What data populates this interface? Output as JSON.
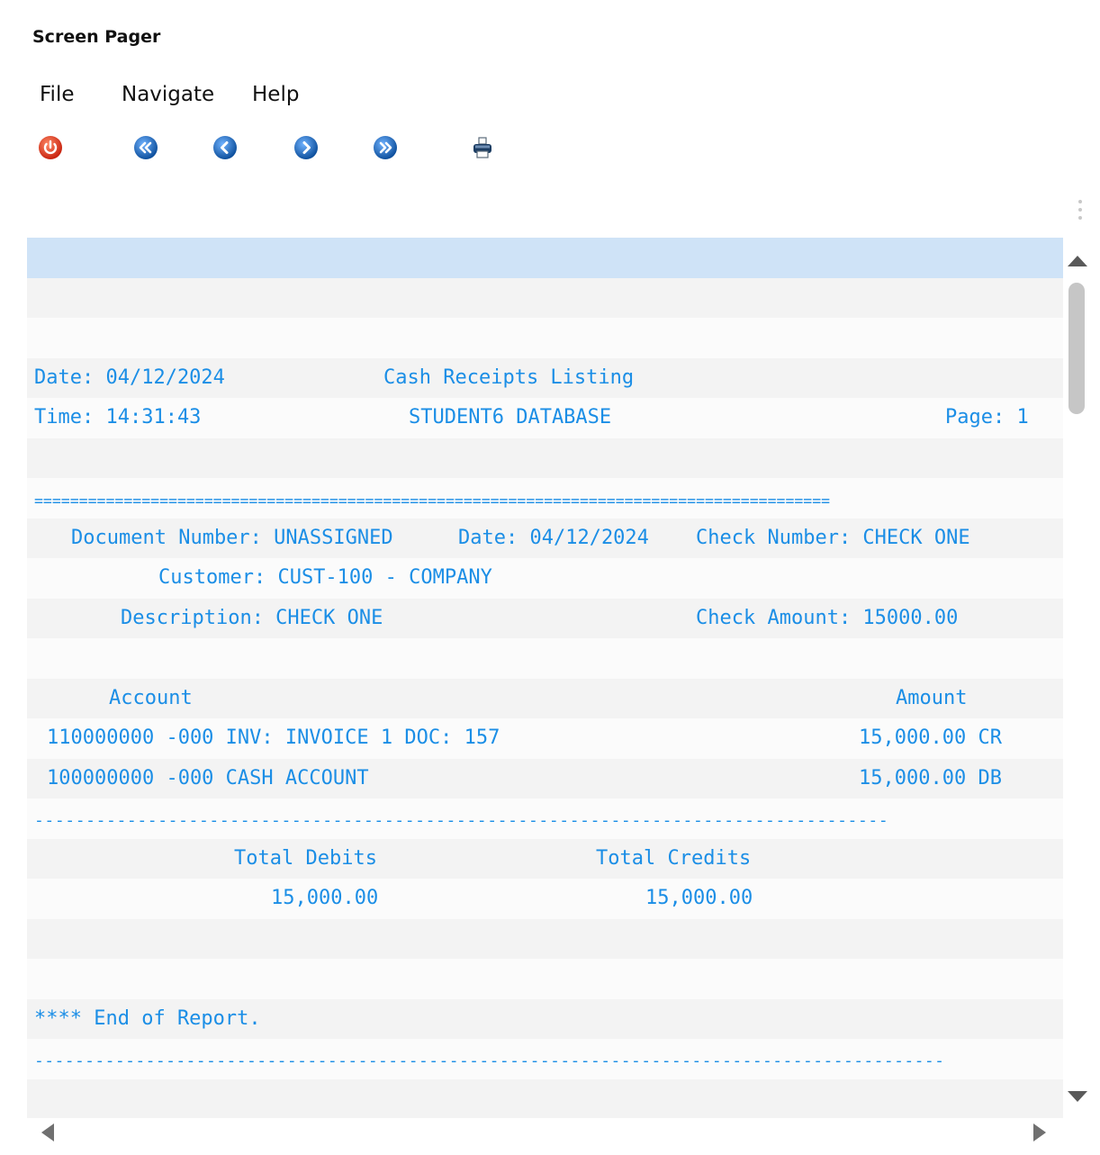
{
  "app": {
    "title": "Screen Pager"
  },
  "menu": {
    "file": "File",
    "navigate": "Navigate",
    "help": "Help"
  },
  "toolbar": {
    "icons": [
      "power-icon",
      "first-page-icon",
      "previous-page-icon",
      "next-page-icon",
      "last-page-icon",
      "print-icon"
    ]
  },
  "colors": {
    "report_text": "#1b8ee6",
    "selection": "#cfe3f7",
    "exit": "#e8351e",
    "nav": "#1567b8"
  },
  "report": {
    "header": {
      "date": "Date: 04/12/2024",
      "title": "Cash Receipts Listing",
      "time": "Time: 14:31:43",
      "database": "STUDENT6 DATABASE",
      "page": "Page: 1"
    },
    "separator_eq": "=========================================================================================",
    "doc": {
      "document_number": "Document Number: UNASSIGNED",
      "date": "Date: 04/12/2024",
      "check_number": "Check Number: CHECK ONE",
      "customer": "Customer: CUST-100 - COMPANY",
      "description": "Description: CHECK ONE",
      "check_amount": "Check Amount: 15000.00"
    },
    "columns": {
      "account": "Account",
      "amount": "Amount"
    },
    "lines": [
      {
        "account": "110000000 -000 INV: INVOICE 1 DOC: 157",
        "amount": "15,000.00 CR"
      },
      {
        "account": "100000000 -000 CASH ACCOUNT",
        "amount": "15,000.00 DB"
      }
    ],
    "separator_dash": "-----------------------------------------------------------------------------------",
    "totals": {
      "debits_label": "Total Debits",
      "credits_label": "Total Credits",
      "debits": "15,000.00",
      "credits": "15,000.00"
    },
    "end": "**** End of Report.",
    "separator_dash_end": "------------------------------------------------------------------------------------------"
  }
}
